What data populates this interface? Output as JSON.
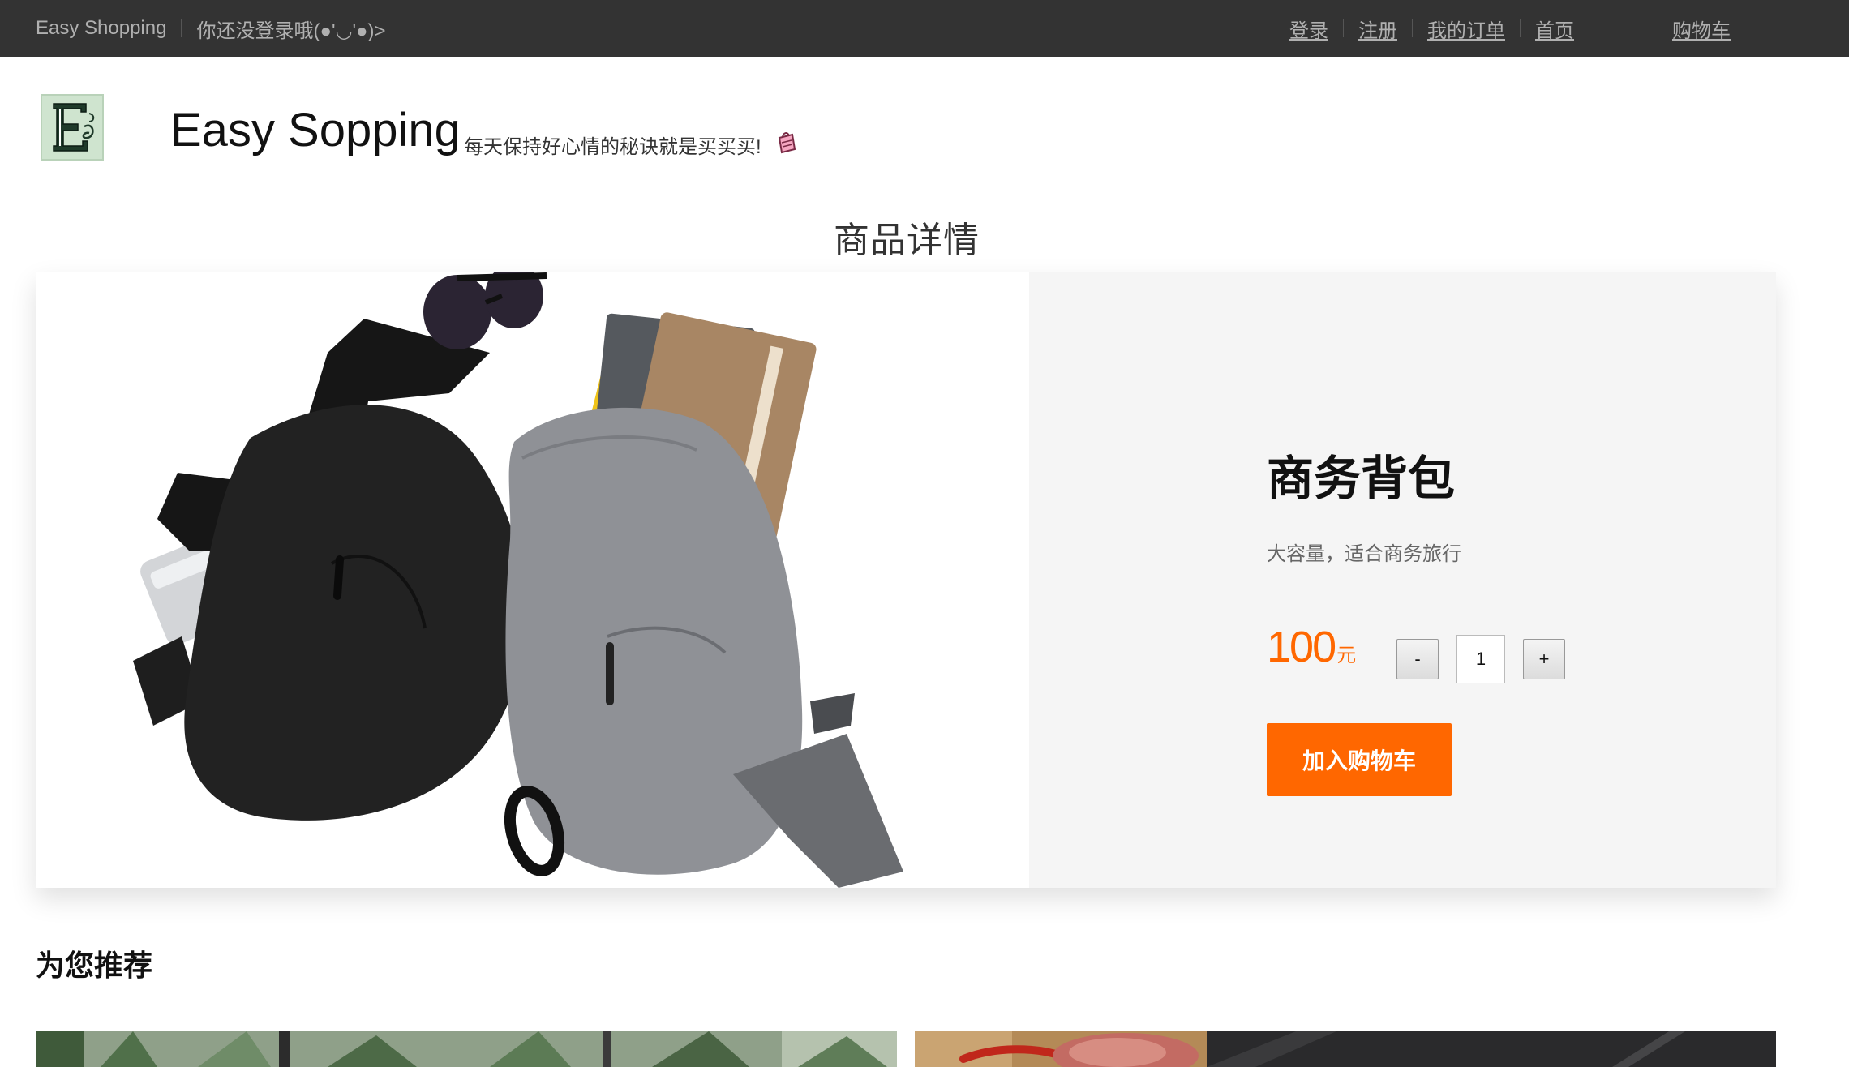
{
  "topbar": {
    "brand": "Easy Shopping",
    "login_hint": "你还没登录哦(●'◡'●)>",
    "links": {
      "login": "登录",
      "register": "注册",
      "orders": "我的订单",
      "home": "首页",
      "cart": "购物车"
    }
  },
  "header": {
    "logo_letter": "E",
    "brand_name": "Easy Sopping",
    "slogan": "每天保持好心情的秘诀就是买买买!"
  },
  "page_title": "商品详情",
  "product": {
    "name": "商务背包",
    "description": "大容量，适合商务旅行",
    "price": "100",
    "currency_unit": "元",
    "quantity": "1",
    "minus_label": "-",
    "plus_label": "+",
    "add_to_cart_label": "加入购物车"
  },
  "recommend": {
    "title": "为您推荐"
  },
  "colors": {
    "topbar_bg": "#333333",
    "accent": "#ff6700",
    "panel_bg": "#f5f5f5"
  }
}
